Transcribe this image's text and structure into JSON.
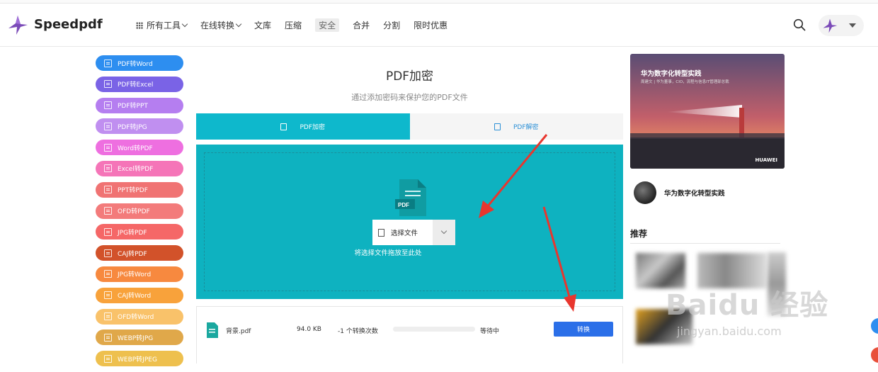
{
  "header": {
    "brand": "Speedpdf",
    "nav": [
      {
        "label": "所有工具",
        "grid": true,
        "dropdown": true
      },
      {
        "label": "在线转换",
        "dropdown": true
      },
      {
        "label": "文库"
      },
      {
        "label": "压缩"
      },
      {
        "label": "安全",
        "active": true
      },
      {
        "label": "合并"
      },
      {
        "label": "分割"
      },
      {
        "label": "限时优惠"
      }
    ]
  },
  "sidebar": {
    "items": [
      {
        "label": "PDF转Word",
        "color": "#2d8ef0"
      },
      {
        "label": "PDF转Excel",
        "color": "#7a63e6"
      },
      {
        "label": "PDF转PPT",
        "color": "#b57ef0"
      },
      {
        "label": "PDF转JPG",
        "color": "#c08ff0"
      },
      {
        "label": "Word转PDF",
        "color": "#ee6fe0"
      },
      {
        "label": "Excel转PDF",
        "color": "#f575b8"
      },
      {
        "label": "PPT转PDF",
        "color": "#f07373"
      },
      {
        "label": "OFD转PDF",
        "color": "#f37b7b"
      },
      {
        "label": "JPG转PDF",
        "color": "#f56767"
      },
      {
        "label": "CAJ转PDF",
        "color": "#d2522a"
      },
      {
        "label": "JPG转Word",
        "color": "#f7893f"
      },
      {
        "label": "CAJ转Word",
        "color": "#f8a23b"
      },
      {
        "label": "OFD转Word",
        "color": "#f9c26a"
      },
      {
        "label": "WEBP转JPG",
        "color": "#e0a84a"
      },
      {
        "label": "WEBP转JPEG",
        "color": "#eec04e"
      }
    ]
  },
  "main": {
    "title": "PDF加密",
    "subtitle": "通过添加密码来保护您的PDF文件",
    "tabs": [
      {
        "label": "PDF加密",
        "active": true
      },
      {
        "label": "PDF解密",
        "active": false
      }
    ],
    "doc_icon_text": "PDF",
    "choose_label": "选择文件",
    "drop_hint": "将选择文件拖放至此处"
  },
  "file": {
    "name": "背景.pdf",
    "size": "94.0 KB",
    "count": "-1 个转换次数",
    "status": "等待中",
    "progress": 0,
    "convert_label": "转换"
  },
  "ad": {
    "title": "华为数字化转型实践",
    "subtitle": "周建文 | 华为董事，CIO，流程与信息IT管理部总裁",
    "brand": "HUAWEI"
  },
  "author": {
    "name": "华为数字化转型实践"
  },
  "recommend": {
    "title": "推荐"
  },
  "watermark": {
    "main": "Baidu 经验",
    "sub": "jingyan.baidu.com"
  },
  "colors": {
    "accent": "#0eb8cc",
    "convert": "#2b6fe8",
    "brand_purple": "#7b4bb8"
  }
}
